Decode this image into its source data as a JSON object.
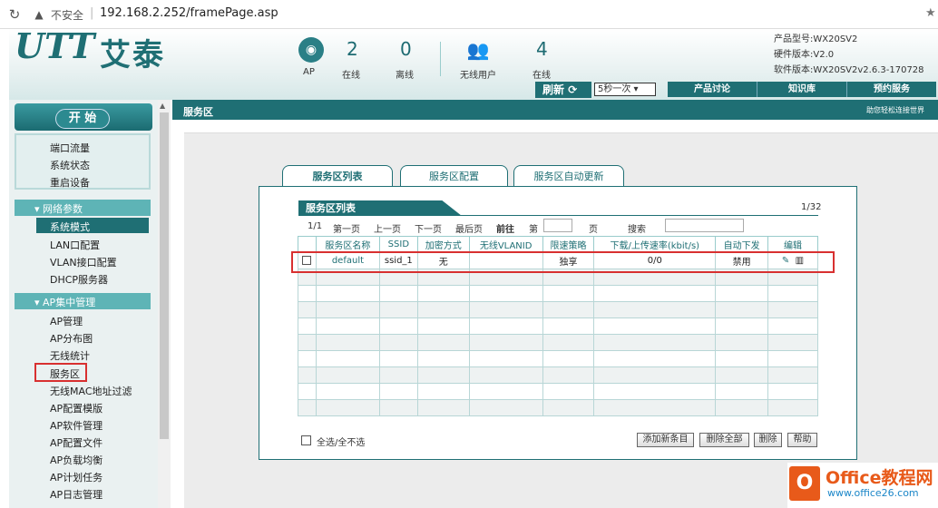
{
  "browser": {
    "insecure": "不安全",
    "separator": "|",
    "url": "192.168.2.252/framePage.asp"
  },
  "header": {
    "logo": "艾泰",
    "stats": [
      {
        "value": "2",
        "label": "在线",
        "group": "AP"
      },
      {
        "value": "0",
        "label": "离线"
      },
      {
        "value": "4",
        "label": "在线",
        "group": "无线用户"
      }
    ],
    "ap_label": "AP",
    "users_label": "无线用户",
    "info": [
      "产品型号:WX20SV2",
      "硬件版本:V2.0",
      "软件版本:WX20SV2v2.6.3-170728"
    ],
    "refresh_label": "刷新",
    "refresh_interval": "5秒一次",
    "links": [
      "产品讨论",
      "知识库",
      "预约服务"
    ]
  },
  "sidebar": {
    "start": "开 始",
    "top_items": [
      "端口流量",
      "系统状态",
      "重启设备"
    ],
    "group1": {
      "label": "网络参数",
      "items": [
        "系统模式",
        "LAN口配置",
        "VLAN接口配置",
        "DHCP服务器"
      ]
    },
    "group2": {
      "label": "AP集中管理",
      "items": [
        "AP管理",
        "AP分布图",
        "无线统计",
        "服务区",
        "无线MAC地址过滤",
        "AP配置模版",
        "AP软件管理",
        "AP配置文件",
        "AP负载均衡",
        "AP计划任务",
        "AP日志管理"
      ]
    }
  },
  "content": {
    "title": "服务区",
    "help": "助您轻松连接世界"
  },
  "tabs": [
    "服务区列表",
    "服务区配置",
    "服务区自动更新"
  ],
  "table": {
    "title": "服务区列表",
    "page_count": "1/32",
    "pager": {
      "pos": "1/1",
      "first": "第一页",
      "prev": "上一页",
      "next": "下一页",
      "last": "最后页",
      "goto": "前往",
      "di": "第",
      "ye": "页",
      "search": "搜索"
    },
    "columns": [
      "",
      "服务区名称",
      "SSID",
      "加密方式",
      "无线VLANID",
      "限速策略",
      "下载/上传速率(kbit/s)",
      "自动下发",
      "编辑"
    ],
    "rows": [
      {
        "name": "default",
        "ssid": "ssid_1",
        "enc": "无",
        "vlan": "",
        "limit": "独享",
        "rate": "0/0",
        "auto": "禁用"
      }
    ],
    "select_all": "全选/全不选",
    "buttons": [
      "添加新条目",
      "删除全部",
      "删除",
      "帮助"
    ]
  },
  "watermark": {
    "title": "Office教程网",
    "url": "www.office26.com"
  }
}
